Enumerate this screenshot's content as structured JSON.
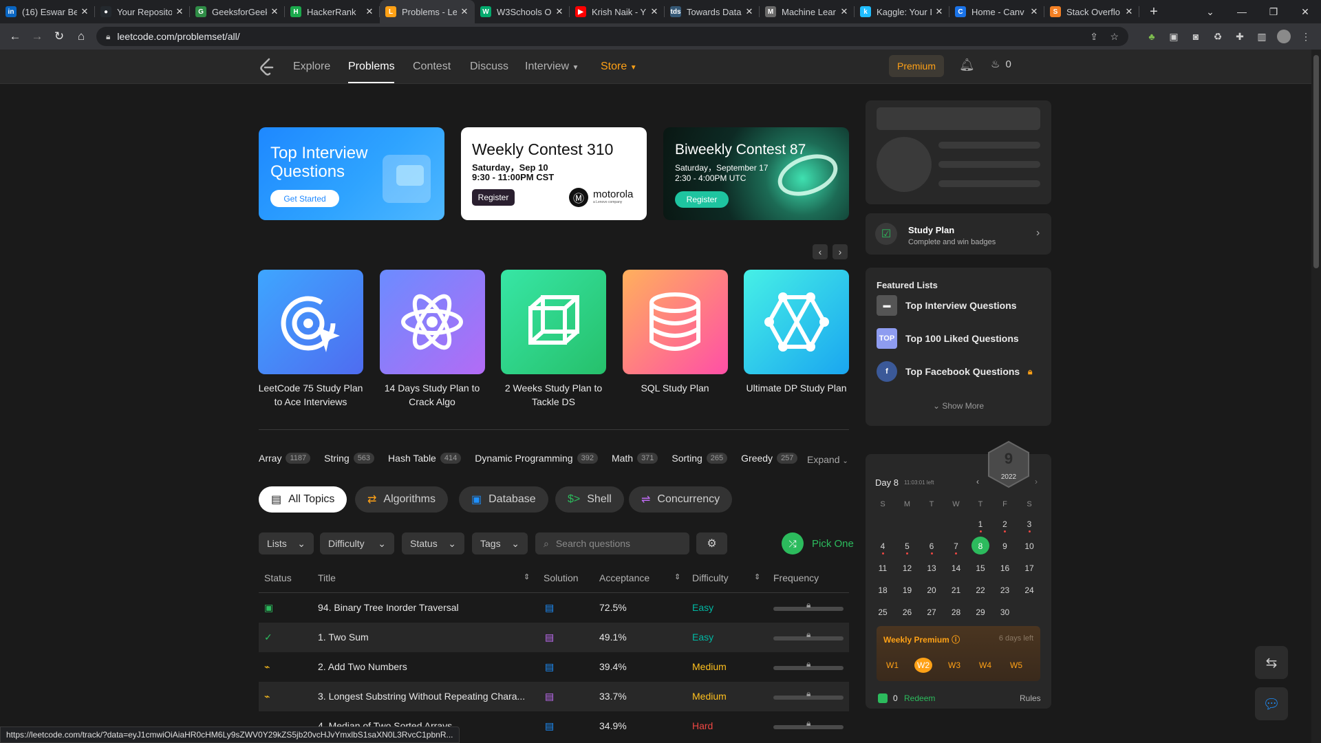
{
  "browser": {
    "tabs": [
      {
        "title": "(16) Eswar Be",
        "icon": "linkedin-icon",
        "color": "#0a66c2",
        "glyph": "in"
      },
      {
        "title": "Your Reposito",
        "icon": "github-icon",
        "color": "#24292e",
        "glyph": "●"
      },
      {
        "title": "GeeksforGeek",
        "icon": "geeksforgeeks-icon",
        "color": "#2f8d46",
        "glyph": "G"
      },
      {
        "title": "HackerRank",
        "icon": "hackerrank-icon",
        "color": "#1ba94c",
        "glyph": "H"
      },
      {
        "title": "Problems - Le",
        "icon": "leetcode-icon",
        "color": "#ffa116",
        "glyph": "L",
        "active": true
      },
      {
        "title": "W3Schools O",
        "icon": "w3schools-icon",
        "color": "#04aa6d",
        "glyph": "W"
      },
      {
        "title": "Krish Naik - Y",
        "icon": "youtube-icon",
        "color": "#ff0000",
        "glyph": "▶"
      },
      {
        "title": "Towards Data",
        "icon": "towardsdatascience-icon",
        "color": "#355876",
        "glyph": "tds"
      },
      {
        "title": "Machine Lear",
        "icon": "machinelearning-icon",
        "color": "#6a6a6a",
        "glyph": "M"
      },
      {
        "title": "Kaggle: Your I",
        "icon": "kaggle-icon",
        "color": "#20beff",
        "glyph": "k"
      },
      {
        "title": "Home - Canv",
        "icon": "canva-icon",
        "color": "#1a73e8",
        "glyph": "C"
      },
      {
        "title": "Stack Overflo",
        "icon": "stackoverflow-icon",
        "color": "#f48024",
        "glyph": "S"
      }
    ],
    "url": "leetcode.com/problemset/all/",
    "status_url": "https://leetcode.com/track/?data=eyJ1cmwiOiAiaHR0cHM6Ly9sZWV0Y29kZS5jb20vcHJvYmxlbS1saXN0L3RvcC1pbnR..."
  },
  "nav": {
    "links": [
      "Explore",
      "Problems",
      "Contest",
      "Discuss",
      "Interview",
      "Store"
    ],
    "premium": "Premium",
    "streak": "0"
  },
  "banners": {
    "top_interview": {
      "title": "Top Interview Questions",
      "button": "Get Started"
    },
    "weekly": {
      "title": "Weekly Contest 310",
      "date": "Saturday，Sep 10",
      "time": "9:30 - 11:00PM CST",
      "button": "Register",
      "sponsor": "motorola",
      "sponsor_sub": "a Lenovo company"
    },
    "biweekly": {
      "title": "Biweekly Contest 87",
      "date": "Saturday，September 17",
      "time": "2:30 - 4:00PM UTC",
      "button": "Register"
    }
  },
  "study_cards": [
    {
      "label": "LeetCode 75 Study Plan to Ace Interviews",
      "icon": "target-cursor-icon",
      "gradient": "linear-gradient(135deg,#3ea6ff,#4f6cf0)"
    },
    {
      "label": "14 Days Study Plan to Crack Algo",
      "icon": "atom-icon",
      "gradient": "linear-gradient(135deg,#6b8cff,#b36bf5)"
    },
    {
      "label": "2 Weeks Study Plan to Tackle DS",
      "icon": "cube-icon",
      "gradient": "linear-gradient(135deg,#37e6a5,#26c06b)"
    },
    {
      "label": "SQL Study Plan",
      "icon": "database-icon",
      "gradient": "linear-gradient(135deg,#ffb05c,#ff4fa6)"
    },
    {
      "label": "Ultimate DP Study Plan",
      "icon": "hexagon-network-icon",
      "gradient": "linear-gradient(135deg,#46f0e6,#1aa6f0)"
    }
  ],
  "tags": [
    {
      "name": "Array",
      "count": "1187"
    },
    {
      "name": "String",
      "count": "563"
    },
    {
      "name": "Hash Table",
      "count": "414"
    },
    {
      "name": "Dynamic Programming",
      "count": "392"
    },
    {
      "name": "Math",
      "count": "371"
    },
    {
      "name": "Sorting",
      "count": "265"
    },
    {
      "name": "Greedy",
      "count": "257"
    }
  ],
  "expand_label": "Expand",
  "topics": [
    "All Topics",
    "Algorithms",
    "Database",
    "Shell",
    "Concurrency"
  ],
  "filters": {
    "lists": "Lists",
    "difficulty": "Difficulty",
    "status": "Status",
    "tags": "Tags",
    "search_placeholder": "Search questions",
    "pick_one": "Pick One"
  },
  "table": {
    "columns": [
      "Status",
      "Title",
      "Solution",
      "Acceptance",
      "Difficulty",
      "Frequency"
    ],
    "rows": [
      {
        "status_icon": "calendar-icon",
        "status_color": "#2cbb5d",
        "title": "94. Binary Tree Inorder Traversal",
        "solution_color": "#1e90ff",
        "acceptance": "72.5%",
        "difficulty": "Easy",
        "difficulty_color": "#00b8a3"
      },
      {
        "status_icon": "check-circle-icon",
        "status_color": "#2cbb5d",
        "title": "1. Two Sum",
        "solution_color": "#c06cf5",
        "acceptance": "49.1%",
        "difficulty": "Easy",
        "difficulty_color": "#00b8a3"
      },
      {
        "status_icon": "attempted-icon",
        "status_color": "#ffc01e",
        "title": "2. Add Two Numbers",
        "solution_color": "#1e90ff",
        "acceptance": "39.4%",
        "difficulty": "Medium",
        "difficulty_color": "#ffc01e"
      },
      {
        "status_icon": "attempted-icon",
        "status_color": "#ffc01e",
        "title": "3. Longest Substring Without Repeating Chara...",
        "solution_color": "#c06cf5",
        "acceptance": "33.7%",
        "difficulty": "Medium",
        "difficulty_color": "#ffc01e"
      },
      {
        "status_icon": "",
        "status_color": "#ffffff",
        "title": "4. Median of Two Sorted Arrays",
        "solution_color": "#1e90ff",
        "acceptance": "34.9%",
        "difficulty": "Hard",
        "difficulty_color": "#ef4743"
      }
    ]
  },
  "sidebar": {
    "study_plan": {
      "title": "Study Plan",
      "subtitle": "Complete and win badges"
    },
    "featured": {
      "heading": "Featured Lists",
      "items": [
        {
          "label": "Top Interview Questions",
          "icon": "laptop-icon",
          "color": "#555555",
          "glyph": "▬"
        },
        {
          "label": "Top 100 Liked Questions",
          "icon": "top-badge-icon",
          "color": "#8e9cf0",
          "glyph": "TOP"
        },
        {
          "label": "Top Facebook Questions",
          "icon": "facebook-icon",
          "color": "#3b5998",
          "glyph": "f",
          "locked": true
        }
      ],
      "show_more": "Show More"
    },
    "calendar": {
      "day_label": "Day 8",
      "time_left": "11:03:01 left",
      "badge_number": "9",
      "badge_year": "2022",
      "weekdays": [
        "S",
        "M",
        "T",
        "W",
        "T",
        "F",
        "S"
      ],
      "weeks": [
        [
          "",
          "",
          "",
          "",
          "1",
          "2",
          "3"
        ],
        [
          "4",
          "5",
          "6",
          "7",
          "8",
          "9",
          "10"
        ],
        [
          "11",
          "12",
          "13",
          "14",
          "15",
          "16",
          "17"
        ],
        [
          "18",
          "19",
          "20",
          "21",
          "22",
          "23",
          "24"
        ],
        [
          "25",
          "26",
          "27",
          "28",
          "29",
          "30",
          ""
        ]
      ],
      "today": "8",
      "missed": [
        "1",
        "2",
        "3",
        "4",
        "5",
        "6",
        "7"
      ],
      "weekly_premium": "Weekly Premium",
      "days_left": "6 days left",
      "week_tabs": [
        "W1",
        "W2",
        "W3",
        "W4",
        "W5"
      ],
      "active_week": "W2",
      "coins": "0",
      "redeem": "Redeem",
      "rules": "Rules"
    }
  },
  "colors": {
    "accent": "#ffa116",
    "green": "#2cbb5d",
    "bg": "#1a1a1a",
    "card": "#282828"
  }
}
